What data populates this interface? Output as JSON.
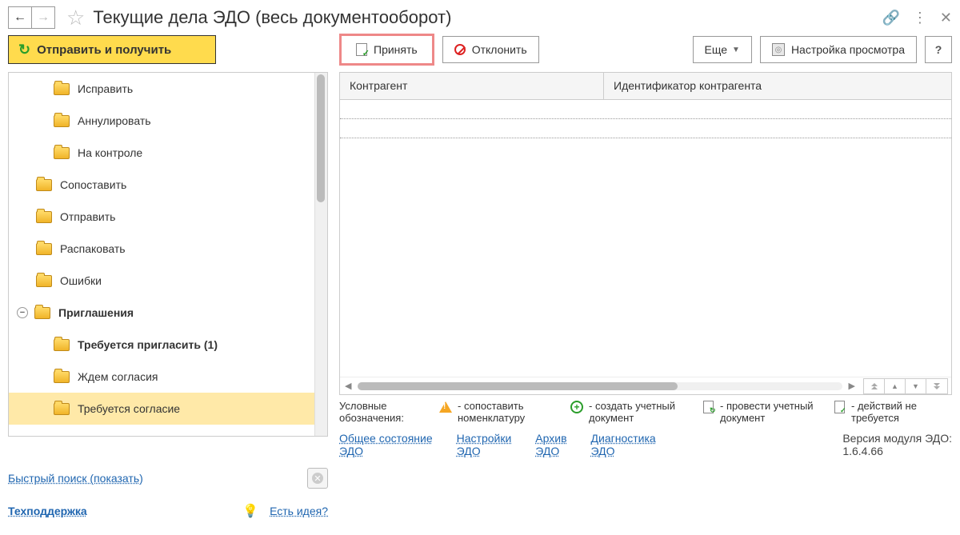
{
  "header": {
    "title": "Текущие дела ЭДО (весь документооборот)"
  },
  "toolbar": {
    "send_receive": "Отправить и получить",
    "accept": "Принять",
    "reject": "Отклонить",
    "more": "Еще",
    "view_settings": "Настройка просмотра",
    "help": "?"
  },
  "tree": [
    {
      "label": "Исправить",
      "level": 1,
      "bold": false
    },
    {
      "label": "Аннулировать",
      "level": 1,
      "bold": false
    },
    {
      "label": "На контроле",
      "level": 1,
      "bold": false
    },
    {
      "label": "Сопоставить",
      "level": 0,
      "bold": false
    },
    {
      "label": "Отправить",
      "level": 0,
      "bold": false
    },
    {
      "label": "Распаковать",
      "level": 0,
      "bold": false
    },
    {
      "label": "Ошибки",
      "level": 0,
      "bold": false
    },
    {
      "label": "Приглашения",
      "level": 0,
      "bold": true,
      "expanded": true
    },
    {
      "label": "Требуется пригласить (1)",
      "level": 1,
      "bold": true
    },
    {
      "label": "Ждем согласия",
      "level": 1,
      "bold": false
    },
    {
      "label": "Требуется согласие",
      "level": 1,
      "bold": false,
      "selected": true
    }
  ],
  "quick_search": "Быстрый поиск (показать)",
  "support": "Техподдержка",
  "idea": "Есть идея?",
  "table": {
    "col1": "Контрагент",
    "col2": "Идентификатор контрагента"
  },
  "legend": {
    "label": "Условные обозначения:",
    "i1": "- сопоставить номенклатуру",
    "i2": "- создать учетный документ",
    "i3": "- провести учетный документ",
    "i4": "- действий не требуется"
  },
  "footer": {
    "general_a": "Общее состояние",
    "general_b": "ЭДО",
    "settings_a": "Настройки",
    "settings_b": "ЭДО",
    "archive_a": "Архив",
    "archive_b": "ЭДО",
    "diag_a": "Диагностика",
    "diag_b": "ЭДО",
    "version_a": "Версия модуля ЭДО:",
    "version_b": "1.6.4.66"
  }
}
